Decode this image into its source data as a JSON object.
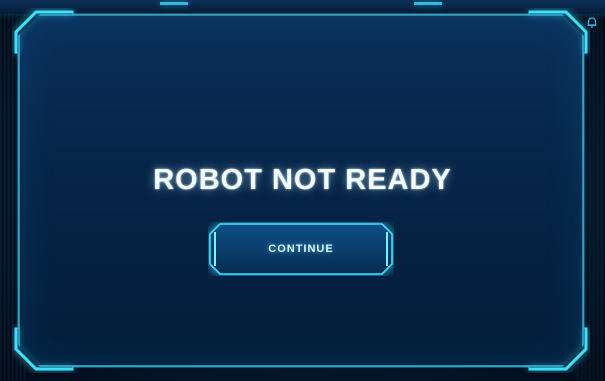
{
  "dialog": {
    "title": "ROBOT NOT READY",
    "continue_label": "CONTINUE"
  },
  "icons": {
    "top_left": "home-icon",
    "top_right": "bell-icon"
  },
  "colors": {
    "background": "#041326",
    "panel": "#062548",
    "accent": "#3fe0ff",
    "text": "#f4fbff"
  }
}
